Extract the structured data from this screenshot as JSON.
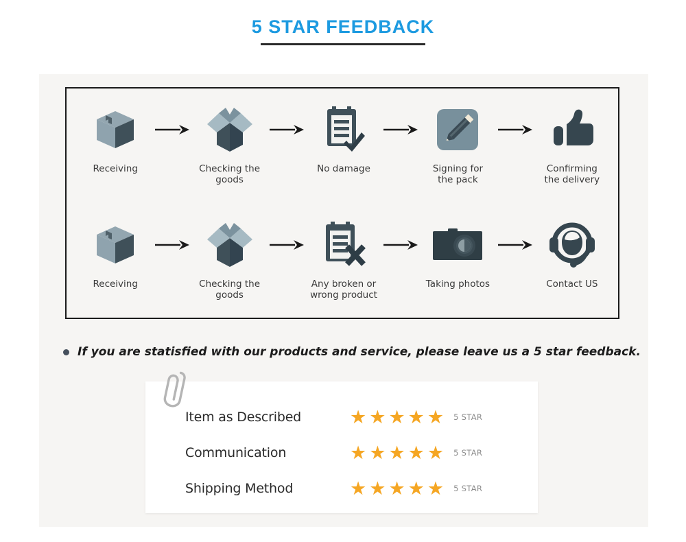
{
  "header": {
    "title": "5 STAR FEEDBACK",
    "accent_color": "#1c9ae0",
    "rule_color": "#2b2b2b"
  },
  "flow": {
    "rows": [
      {
        "id": "normal-delivery-flow",
        "steps": [
          {
            "icon": "closed-box-icon",
            "label": "Receiving"
          },
          {
            "icon": "open-box-icon",
            "label": "Checking the\ngoods",
            "line1": "Checking the",
            "line2": "goods"
          },
          {
            "icon": "clipboard-check-icon",
            "label": "No damage"
          },
          {
            "icon": "pencil-sign-icon",
            "label": "Signing for\nthe pack",
            "line1": "Signing for",
            "line2": "the pack"
          },
          {
            "icon": "thumbs-up-icon",
            "label": "Confirming\nthe delivery",
            "line1": "Confirming",
            "line2": "the delivery"
          }
        ]
      },
      {
        "id": "problem-delivery-flow",
        "steps": [
          {
            "icon": "closed-box-icon",
            "label": "Receiving"
          },
          {
            "icon": "open-box-icon",
            "label": "Checking the\ngoods",
            "line1": "Checking the",
            "line2": "goods"
          },
          {
            "icon": "clipboard-x-icon",
            "label": "Any broken or\nwrong product",
            "line1": "Any broken or",
            "line2": "wrong product"
          },
          {
            "icon": "camera-icon",
            "label": "Taking photos"
          },
          {
            "icon": "headset-support-icon",
            "label": "Contact US"
          }
        ]
      }
    ],
    "arrow_icon": "arrow-right-icon",
    "border_color": "#1a1a1a",
    "panel_color": "#f6f5f3"
  },
  "note": {
    "bullet_icon": "bullet-dot-icon",
    "text": "If you are statisfied with our products and service, please leave us a 5 star feedback."
  },
  "rating_card": {
    "clip_icon": "paperclip-icon",
    "star_glyph": "★",
    "star_color": "#f5a623",
    "rows": [
      {
        "name": "Item as Described",
        "stars": 5,
        "rating_label": "5 STAR"
      },
      {
        "name": "Communication",
        "stars": 5,
        "rating_label": "5 STAR"
      },
      {
        "name": "Shipping Method",
        "stars": 5,
        "rating_label": "5 STAR"
      }
    ]
  }
}
